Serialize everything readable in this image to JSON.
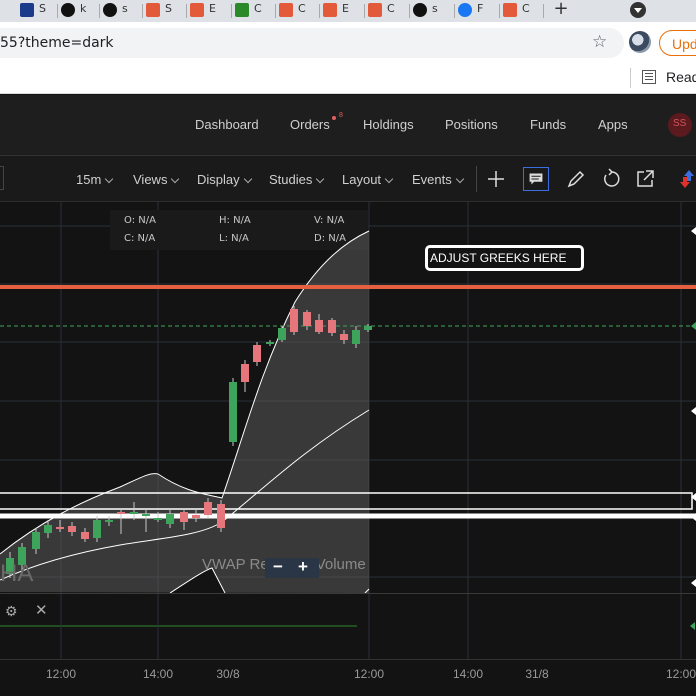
{
  "browser": {
    "tabs": [
      {
        "label": "S",
        "icon": "chart-icon",
        "color": "#1a3a8a"
      },
      {
        "label": "k",
        "icon": "github-icon",
        "color": "#111111"
      },
      {
        "label": "s",
        "icon": "github-icon",
        "color": "#111111"
      },
      {
        "label": "S",
        "icon": "kite-icon",
        "color": "#e25a3a"
      },
      {
        "label": "E",
        "icon": "kite-icon",
        "color": "#e25a3a"
      },
      {
        "label": "C",
        "icon": "td-icon",
        "color": "#2a8a2a"
      },
      {
        "label": "C",
        "icon": "kite-icon",
        "color": "#e25a3a"
      },
      {
        "label": "E",
        "icon": "kite-icon",
        "color": "#e25a3a"
      },
      {
        "label": "C",
        "icon": "kite-icon",
        "color": "#e25a3a"
      },
      {
        "label": "s",
        "icon": "github-icon",
        "color": "#111111"
      },
      {
        "label": "F",
        "icon": "facebook-icon",
        "color": "#1877f2"
      },
      {
        "label": "C",
        "icon": "kite-icon",
        "color": "#e25a3a"
      }
    ],
    "new_tab": "+",
    "url": "55?theme=dark",
    "update_label": "Upd",
    "reading_list_label": "Read"
  },
  "kite_nav": {
    "items": [
      "Dashboard",
      "Orders",
      "Holdings",
      "Positions",
      "Funds",
      "Apps"
    ],
    "orders_badge": "8",
    "user_initials": "SS"
  },
  "toolbar": {
    "interval": "15m",
    "views": "Views",
    "display": "Display",
    "studies": "Studies",
    "layout": "Layout",
    "events": "Events"
  },
  "ohlc": {
    "o_label": "O:",
    "o_value": "N/A",
    "h_label": "H:",
    "h_value": "N/A",
    "v_label": "V:",
    "v_value": "N/A",
    "c_label": "C:",
    "c_value": "N/A",
    "l_label": "L:",
    "l_value": "N/A",
    "d_label": "D:",
    "d_value": "N/A"
  },
  "greeks_button": "ADJUST GREEKS HERE",
  "indicator_label": "VWAP Re",
  "indicator_label_tail": "Volume",
  "indicator_ha": "HA",
  "zoom": {
    "minus": "−",
    "plus": "+"
  },
  "colors": {
    "up": "#3fa45b",
    "down": "#e5767b",
    "orange_line": "#e5603e",
    "green_dash": "#3fa45b"
  },
  "time_axis": [
    "12:00",
    "14:00",
    "30/8",
    "12:00",
    "14:00",
    "31/8",
    "12:00"
  ]
}
